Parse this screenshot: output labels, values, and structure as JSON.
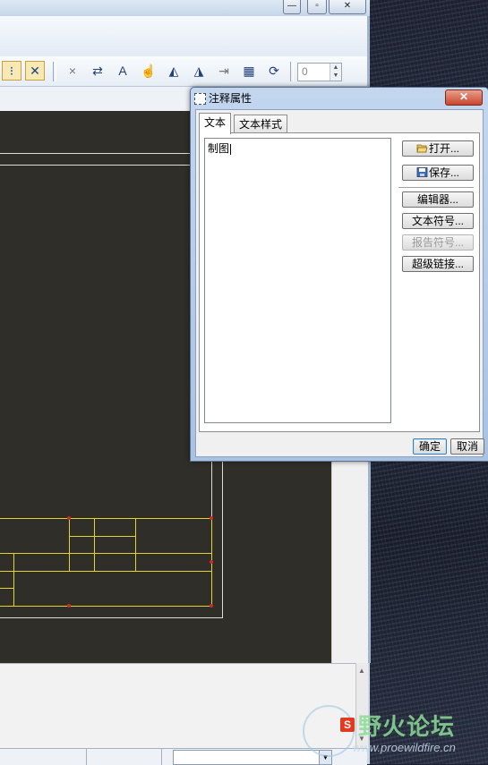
{
  "dialog": {
    "title": "注释属性",
    "close_label": "✕",
    "tabs": [
      {
        "label": "文本"
      },
      {
        "label": "文本样式"
      }
    ],
    "text_value": "制图",
    "buttons": {
      "open": "打开...",
      "save": "保存...",
      "editor": "编辑器...",
      "text_symbol": "文本符号...",
      "report_symbol": "报告符号...",
      "hyperlink": "超级链接..."
    },
    "ok": "确定",
    "cancel": "取消"
  },
  "toolbar": {
    "spinner_value": "0"
  },
  "window": {
    "minimize": "—",
    "maximize": "▫",
    "close": "✕"
  },
  "watermark": {
    "badge": "S",
    "brand": "野火论坛",
    "url": "www.proewildfire.cn"
  },
  "colors": {
    "drawing_background": "#2f2e28",
    "title_block_lines": "#e2d42a",
    "vertex_markers": "#d8262a",
    "dialog_frame": "#a9c2e2"
  }
}
